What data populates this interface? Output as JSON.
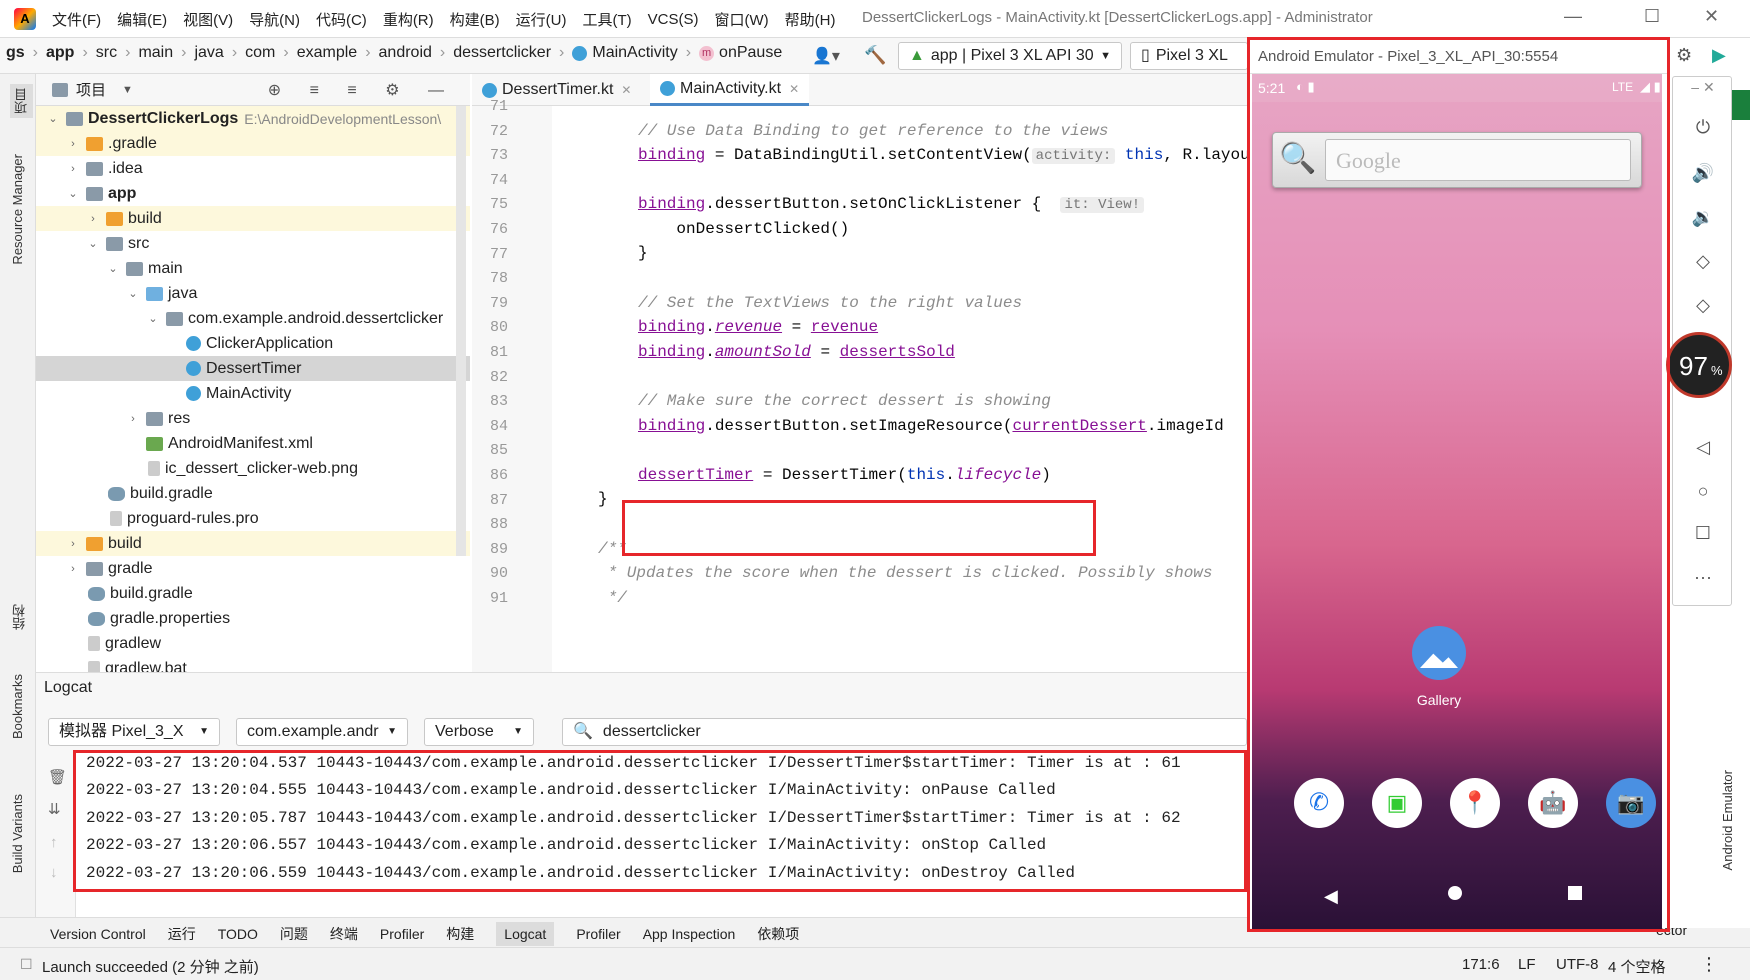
{
  "titlebar": {
    "menus": [
      "文件(F)",
      "编辑(E)",
      "视图(V)",
      "导航(N)",
      "代码(C)",
      "重构(R)",
      "构建(B)",
      "运行(U)",
      "工具(T)",
      "VCS(S)",
      "窗口(W)",
      "帮助(H)"
    ],
    "title": "DessertClickerLogs - MainActivity.kt [DessertClickerLogs.app] - Administrator"
  },
  "breadcrumbs": [
    "gs",
    "app",
    "src",
    "main",
    "java",
    "com",
    "example",
    "android",
    "dessertclicker",
    "MainActivity",
    "onPause"
  ],
  "toolbar": {
    "run_config": "app | Pixel 3 XL API 30",
    "device": "Pixel 3 XL"
  },
  "project_panel": {
    "title": "项目",
    "tree": [
      {
        "label": "DessertClickerLogs",
        "extra": "E:\\AndroidDevelopmentLesson\\",
        "bold": true
      },
      {
        "label": ".gradle"
      },
      {
        "label": ".idea"
      },
      {
        "label": "app",
        "bold": true
      },
      {
        "label": "build"
      },
      {
        "label": "src"
      },
      {
        "label": "main"
      },
      {
        "label": "java"
      },
      {
        "label": "com.example.android.dessertclicker"
      },
      {
        "label": "ClickerApplication"
      },
      {
        "label": "DessertTimer"
      },
      {
        "label": "MainActivity"
      },
      {
        "label": "res"
      },
      {
        "label": "AndroidManifest.xml"
      },
      {
        "label": "ic_dessert_clicker-web.png"
      },
      {
        "label": "build.gradle"
      },
      {
        "label": "proguard-rules.pro"
      },
      {
        "label": "build"
      },
      {
        "label": "gradle"
      },
      {
        "label": "build.gradle"
      },
      {
        "label": "gradle.properties"
      },
      {
        "label": "gradlew"
      },
      {
        "label": "gradlew.bat"
      }
    ]
  },
  "left_strip": {
    "project": "项目",
    "resource_manager": "Resource Manager",
    "structure": "结构",
    "bookmarks": "Bookmarks",
    "build_variants": "Build Variants"
  },
  "editor": {
    "tabs": [
      {
        "label": "DessertTimer.kt"
      },
      {
        "label": "MainActivity.kt"
      }
    ],
    "line_numbers": [
      "71",
      "72",
      "73",
      "74",
      "75",
      "76",
      "77",
      "78",
      "79",
      "80",
      "81",
      "82",
      "83",
      "84",
      "85",
      "86",
      "87",
      "88",
      "89",
      "90",
      "91"
    ],
    "comments": {
      "c72": "// Use Data Binding to get reference to the views",
      "c79": "// Set the TextViews to the right values",
      "c83": "// Make sure the correct dessert is showing",
      "c89": "/**",
      "c90": " * Updates the score when the dessert is clicked. Possibly shows",
      "c91": " */"
    },
    "code": {
      "binding": "binding",
      "l73_a": " = DataBindingUtil.setContentView(",
      "l73_hint": "activity:",
      "l73_this": "this",
      "l73_b": ", R.layou",
      "l75_a": ".dessertButton.setOnClickListener {",
      "l75_hint": "it: View!",
      "l76": "    onDessertClicked()",
      "l77": "}",
      "dot": ".",
      "revenue": "revenue",
      "eq": " = ",
      "amountSold": "amountSold",
      "dessertsSold": "dessertsSold",
      "l84_a": ".dessertButton.setImageResource(",
      "currentDessert": "currentDessert",
      "l84_b": ".imageId",
      "dessertTimer": "dessertTimer",
      "l86_a": " = DessertTimer(",
      "l86_this": "this",
      "lifecycle": "lifecycle",
      "l86_end": ")",
      "l87": "}"
    }
  },
  "logcat": {
    "title": "Logcat",
    "device": "模拟器 Pixel_3_X",
    "package": "com.example.andr",
    "level": "Verbose",
    "filter": "dessertclicker",
    "lines": [
      "2022-03-27 13:20:04.537 10443-10443/com.example.android.dessertclicker I/DessertTimer$startTimer: Timer is at : 61",
      "2022-03-27 13:20:04.555 10443-10443/com.example.android.dessertclicker I/MainActivity: onPause Called",
      "2022-03-27 13:20:05.787 10443-10443/com.example.android.dessertclicker I/DessertTimer$startTimer: Timer is at : 62",
      "2022-03-27 13:20:06.557 10443-10443/com.example.android.dessertclicker I/MainActivity: onStop Called",
      "2022-03-27 13:20:06.559 10443-10443/com.example.android.dessertclicker I/MainActivity: onDestroy Called"
    ]
  },
  "bottom_tools": [
    "Version Control",
    "运行",
    "TODO",
    "问题",
    "终端",
    "Profiler",
    "构建",
    "Logcat",
    "Profiler",
    "App Inspection",
    "依赖项"
  ],
  "statusbar": {
    "message": "Launch succeeded (2 分钟 之前)",
    "position": "171:6",
    "line_sep": "LF",
    "encoding": "UTF-8",
    "indent": "4 个空格",
    "right_label": "ector"
  },
  "emulator": {
    "title": "Android Emulator - Pixel_3_XL_API_30:5554",
    "time": "5:21",
    "network": "LTE",
    "search_placeholder": "Google",
    "gallery_label": "Gallery",
    "cpu_percent": "97",
    "cpu_unit": "%",
    "side_label": "Android Emulator"
  },
  "colors": {
    "highlight_box": "#e6262a",
    "accent": "#4a88c7"
  }
}
